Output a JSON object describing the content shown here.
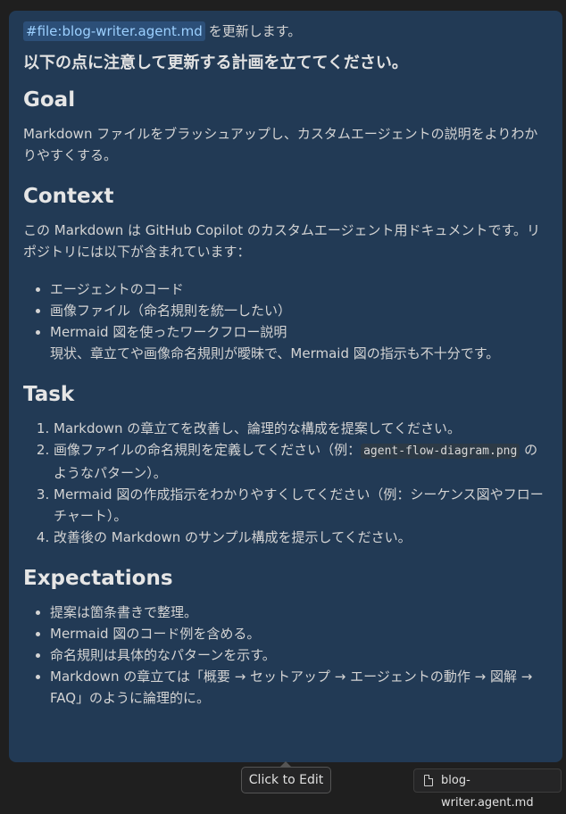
{
  "message": {
    "file_ref": "#file:blog-writer.agent.md",
    "intro_suffix": "を更新します。",
    "instruction": "以下の点に注意して更新する計画を立ててください。",
    "sections": {
      "goal": {
        "heading": "Goal",
        "text": "Markdown ファイルをブラッシュアップし、カスタムエージェントの説明をよりわかりやすくする。"
      },
      "context": {
        "heading": "Context",
        "text": "この Markdown は GitHub Copilot のカスタムエージェント用ドキュメントです。リポジトリには以下が含まれています：",
        "items": [
          "エージェントのコード",
          "画像ファイル（命名規則を統一したい）",
          "Mermaid 図を使ったワークフロー説明"
        ],
        "note": "現状、章立てや画像命名規則が曖昧で、Mermaid 図の指示も不十分です。"
      },
      "task": {
        "heading": "Task",
        "items": [
          "Markdown の章立てを改善し、論理的な構成を提案してください。",
          "画像ファイルの命名規則を定義してください（例：",
          "Mermaid 図の作成指示をわかりやすくしてください（例：シーケンス図やフローチャート）。",
          "改善後の Markdown のサンプル構成を提示してください。"
        ],
        "code_example": "agent-flow-diagram.png",
        "item2_suffix": " のようなパターン）。"
      },
      "expectations": {
        "heading": "Expectations",
        "items": [
          "提案は箇条書きで整理。",
          "Mermaid 図のコード例を含める。",
          "命名規則は具体的なパターンを示す。",
          "Markdown の章立ては「概要 → セットアップ → エージェントの動作 → 図解 → FAQ」のように論理的に。"
        ]
      }
    }
  },
  "tooltip": {
    "label": "Click to Edit"
  },
  "attachment": {
    "filename": "blog-writer.agent.md",
    "icon": "file-icon"
  },
  "colors": {
    "bubble_bg": "#223a55",
    "chip_fg": "#9cd0ff",
    "background": "#1f1f1f"
  }
}
